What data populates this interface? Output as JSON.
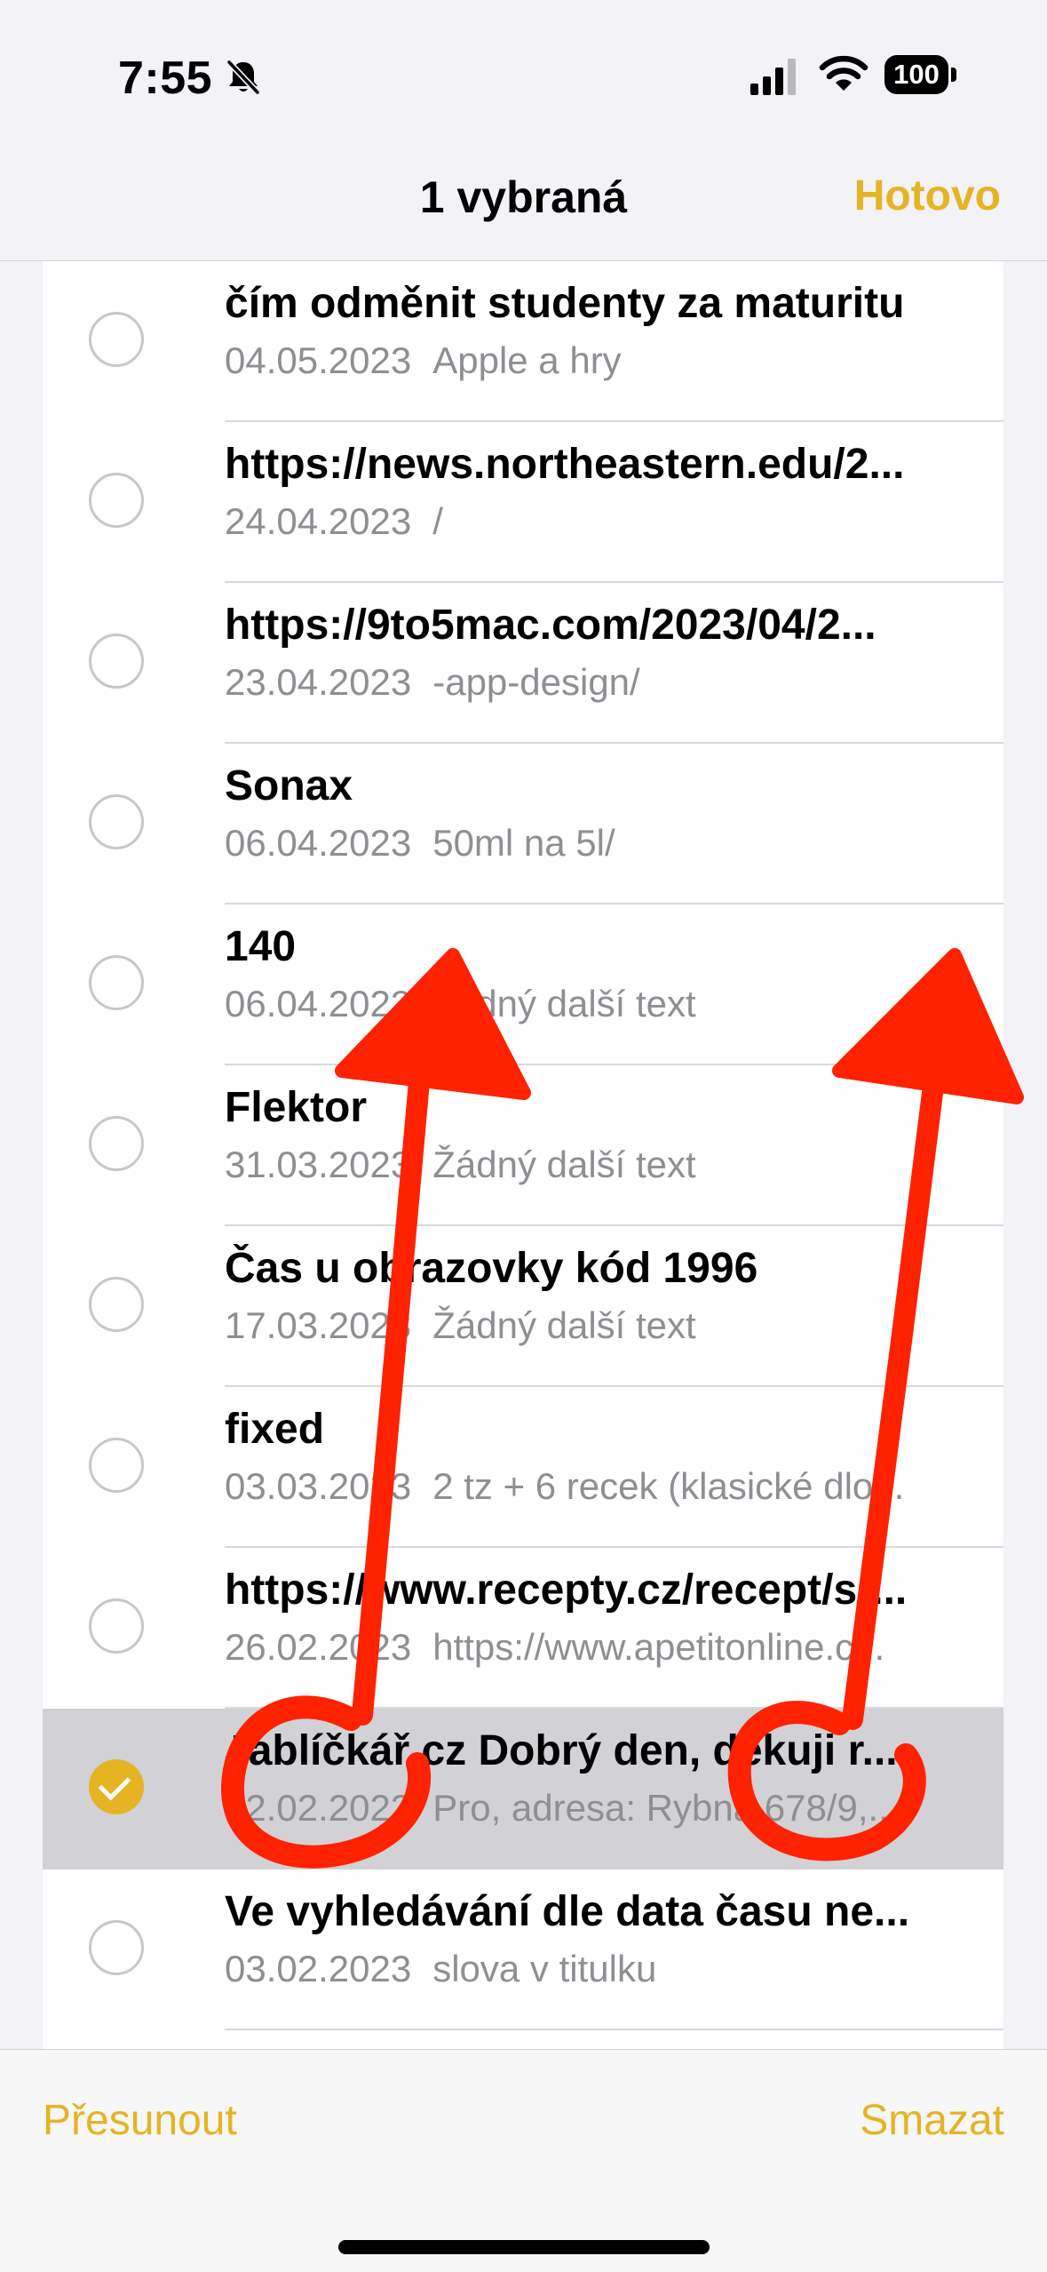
{
  "status_bar": {
    "time": "7:55",
    "battery": "100",
    "icons": [
      "bell-slash-icon",
      "cellular-signal-icon",
      "wifi-icon",
      "battery-icon"
    ]
  },
  "nav": {
    "title": "1 vybraná",
    "done_label": "Hotovo"
  },
  "notes": [
    {
      "title": "čím odměnit studenty za maturitu",
      "date": "04.05.2023",
      "preview": "Apple a hry",
      "selected": false
    },
    {
      "title": "https://news.northeastern.edu/2...",
      "date": "24.04.2023",
      "preview": "/",
      "selected": false
    },
    {
      "title": "https://9to5mac.com/2023/04/2...",
      "date": "23.04.2023",
      "preview": "-app-design/",
      "selected": false
    },
    {
      "title": "Sonax",
      "date": "06.04.2023",
      "preview": "50ml na 5l/",
      "selected": false
    },
    {
      "title": "140",
      "date": "06.04.2023",
      "preview": "Žádný další text",
      "selected": false
    },
    {
      "title": "Flektor",
      "date": "31.03.2023",
      "preview": "Žádný další text",
      "selected": false
    },
    {
      "title": "Čas u obrazovky kód 1996",
      "date": "17.03.2023",
      "preview": "Žádný další text",
      "selected": false
    },
    {
      "title": "fixed",
      "date": "03.03.2023",
      "preview": "2 tz + 6 recek (klasické dlo...",
      "selected": false
    },
    {
      "title": "https://www.recepty.cz/recept/sr...",
      "date": "26.02.2023",
      "preview": "https://www.apetitonline.c...",
      "selected": false
    },
    {
      "title": "Jablíčkář.cz Dobrý den, děkuji r...",
      "date": "22.02.2023",
      "preview": "Pro, adresa: Rybná 678/9,...",
      "selected": true
    },
    {
      "title": "Ve vyhledávání dle data času ne...",
      "date": "03.02.2023",
      "preview": "slova v titulku",
      "selected": false
    }
  ],
  "toolbar": {
    "move_label": "Přesunout",
    "delete_label": "Smazat"
  },
  "colors": {
    "accent": "#e6b322",
    "annotation": "#ff2200",
    "selected_row": "#d1d1d6",
    "secondary_text": "#8e8e93"
  }
}
